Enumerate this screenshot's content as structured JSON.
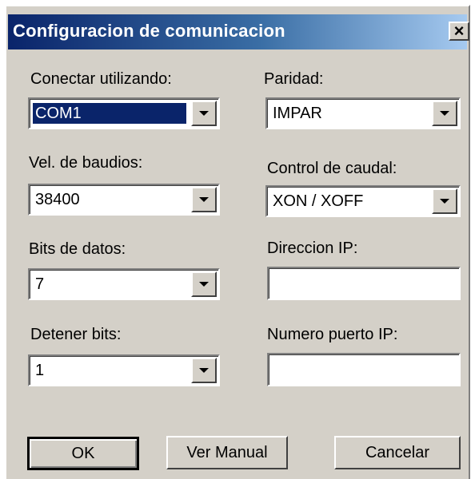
{
  "window": {
    "title": "Configuracion de comunicacion",
    "close_glyph": "×"
  },
  "fields": {
    "connect_label": "Conectar utilizando:",
    "connect_value": "COM1",
    "parity_label": "Paridad:",
    "parity_value": "IMPAR",
    "baud_label": "Vel. de baudios:",
    "baud_value": "38400",
    "flow_label": "Control de caudal:",
    "flow_value": "XON / XOFF",
    "databits_label": "Bits de datos:",
    "databits_value": "7",
    "ip_label": "Direccion IP:",
    "ip_value": "",
    "stopbits_label": "Detener bits:",
    "stopbits_value": "1",
    "port_label": "Numero puerto IP:",
    "port_value": ""
  },
  "buttons": {
    "ok": "OK",
    "manual": "Ver Manual",
    "cancel": "Cancelar"
  },
  "colors": {
    "title_start": "#0a246a",
    "title_end": "#a6caf0",
    "face": "#d4d0c8",
    "selection": "#0a246a"
  }
}
